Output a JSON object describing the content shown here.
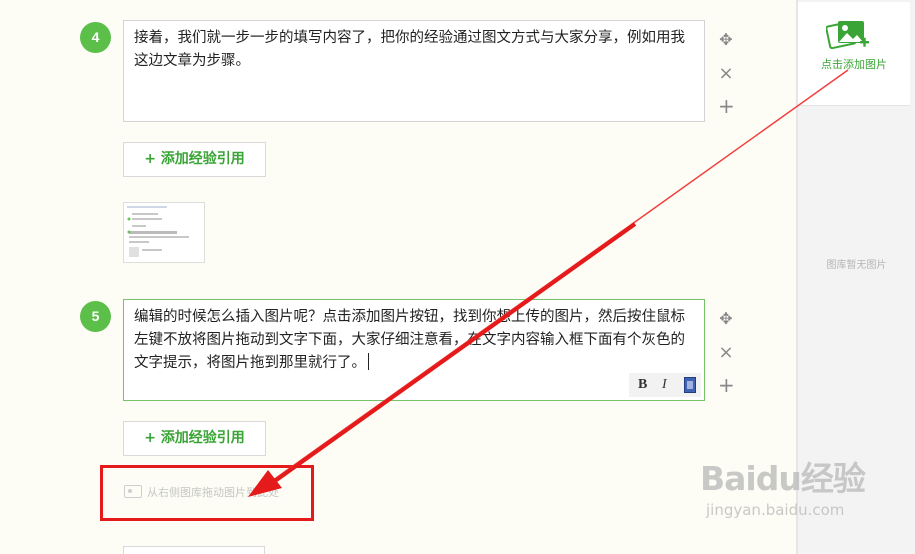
{
  "steps": [
    {
      "number": "4",
      "text": "接着，我们就一步一步的填写内容了，把你的经验通过图文方式与大家分享，例如用我这边文章为步骤。"
    },
    {
      "number": "5",
      "text": "编辑的时候怎么插入图片呢？点击添加图片按钮，找到你想上传的图片，然后按住鼠标左键不放将图片拖动到文字下面，大家仔细注意看，在文字内容输入框下面有个灰色的文字提示，将图片拖到那里就行了。"
    }
  ],
  "controls": {
    "move": "✥",
    "delete": "×",
    "add": "+"
  },
  "ref_button_label": "+ 添加经验引用",
  "toolbar": {
    "bold": "B",
    "italic": "I"
  },
  "drop_hint": "从右侧图库拖动图片到此处",
  "sidebar": {
    "add_image_label": "点击添加图片",
    "empty_library": "图库暂无图片"
  },
  "watermark": {
    "logo": "Baidu经验",
    "url": "jingyan.baidu.com"
  },
  "colors": {
    "accent_green": "#5cbf4a",
    "annotation_red": "#e51a1a"
  },
  "icons": [
    "add-image-icon",
    "move-icon",
    "delete-icon",
    "add-step-icon",
    "image-placeholder-icon",
    "film-icon"
  ]
}
